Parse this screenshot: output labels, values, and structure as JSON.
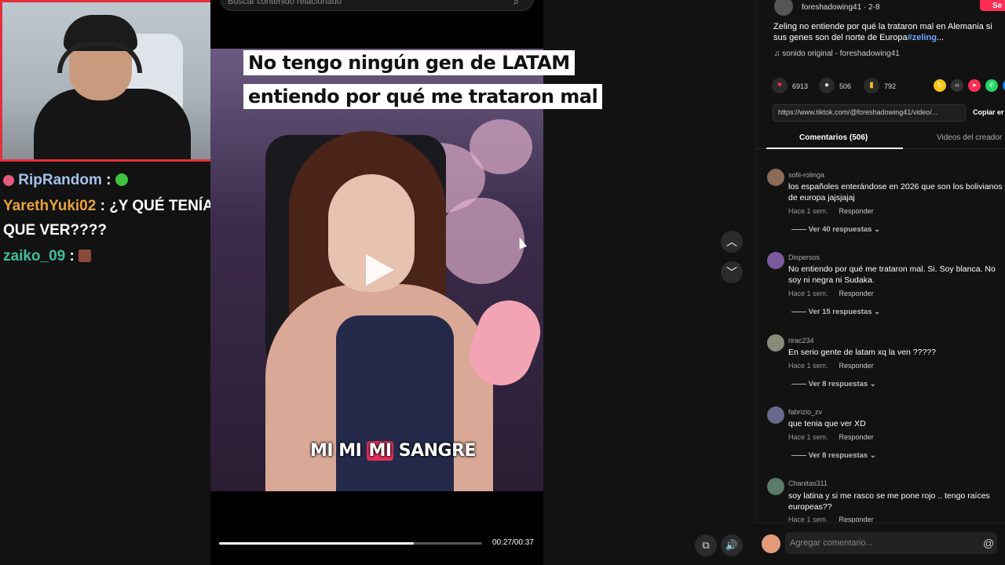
{
  "stream": {
    "chat": [
      {
        "user": "RipRandom",
        "sep": " : ",
        "text": "",
        "color": "#a2c3e8",
        "emote_color": "#3fc63f",
        "badge_color": "#e45a7a"
      },
      {
        "user": "YarethYuki02",
        "sep": " : ",
        "text": "¿Y QUÉ TENÍA QUE VER????",
        "color": "#e8a23a"
      },
      {
        "user": "zaiko_09",
        "sep": " : ",
        "text": "",
        "color": "#3fbf9a",
        "emote_color": "#8a4a3a"
      }
    ]
  },
  "search": {
    "placeholder": "Buscar contenido relacionado",
    "icon": "search-icon"
  },
  "video": {
    "caption_line1": "No tengo ningún gen de LATAM",
    "caption_line2": "entiendo por qué me trataron mal",
    "subtitle_pre": "MI MI ",
    "subtitle_highlight": "MI",
    "subtitle_post": " SANGRE",
    "progress": 0.74,
    "time": "00:27/00:37",
    "play_icon": "play-icon"
  },
  "nav": {
    "up_icon": "chevron-up-icon",
    "down_icon": "chevron-down-icon",
    "up_glyph": "︿",
    "down_glyph": "﹀"
  },
  "controls": {
    "pip_glyph": "⧉",
    "volume_glyph": "🔊"
  },
  "post": {
    "author": "foreshadowing41 · 2-8",
    "follow_label": "Se",
    "description": "Zeling no entiende por qué la trataron mal en Alemania si sus genes son del norte de Europa",
    "description_tag": "#zeling",
    "description_more": "...",
    "sound": "♫  sonido original - foreshadowing41",
    "likes": "6913",
    "comments": "506",
    "saves": "792",
    "link": "https://www.tiktok.com/@foreshadowing41/video/...",
    "copy_label": "Copiar er",
    "colors": {
      "like": "#fe2c55",
      "save": "#f5c518"
    }
  },
  "tabs": {
    "comments": "Comentarios (506)",
    "videos": "Videos del creador"
  },
  "comments": [
    {
      "user": "sofii-rolinga",
      "text": "los españoles enterándose en 2026 que son los bolivianos de europa jajsjajaj",
      "time": "Hace 1 sem.",
      "reply": "Responder",
      "more": "Ver 40 respuestas ⌄",
      "avatar_color": "#8b6a5a"
    },
    {
      "user": "Dispersos",
      "text": "No entiendo por qué me trataron mal. Si. Soy blanca. No soy ni negra ni Sudaka.",
      "time": "Hace 1 sem.",
      "reply": "Responder",
      "more": "Ver 15 respuestas ⌄",
      "avatar_color": "#7a5a9a"
    },
    {
      "user": "rirac234",
      "text": "En serio gente de latam xq la ven ?????",
      "time": "Hace 1 sem.",
      "reply": "Responder",
      "more": "Ver 8 respuestas ⌄",
      "avatar_color": "#8a8a7a"
    },
    {
      "user": "fabrizio_zv",
      "text": "que tenia que ver XD",
      "time": "Hace 1 sem.",
      "reply": "Responder",
      "more": "Ver 8 respuestas ⌄",
      "avatar_color": "#6a6a8a"
    },
    {
      "user": "Chanitas311",
      "text": "soy latina y si me rasco se me pone rojo .. tengo raíces europeas??",
      "time": "Hace 1 sem.",
      "reply": "Responder",
      "more": "",
      "avatar_color": "#5a7a6a"
    }
  ],
  "comment_box": {
    "placeholder": "Agregar comentario...",
    "at_glyph": "@"
  }
}
